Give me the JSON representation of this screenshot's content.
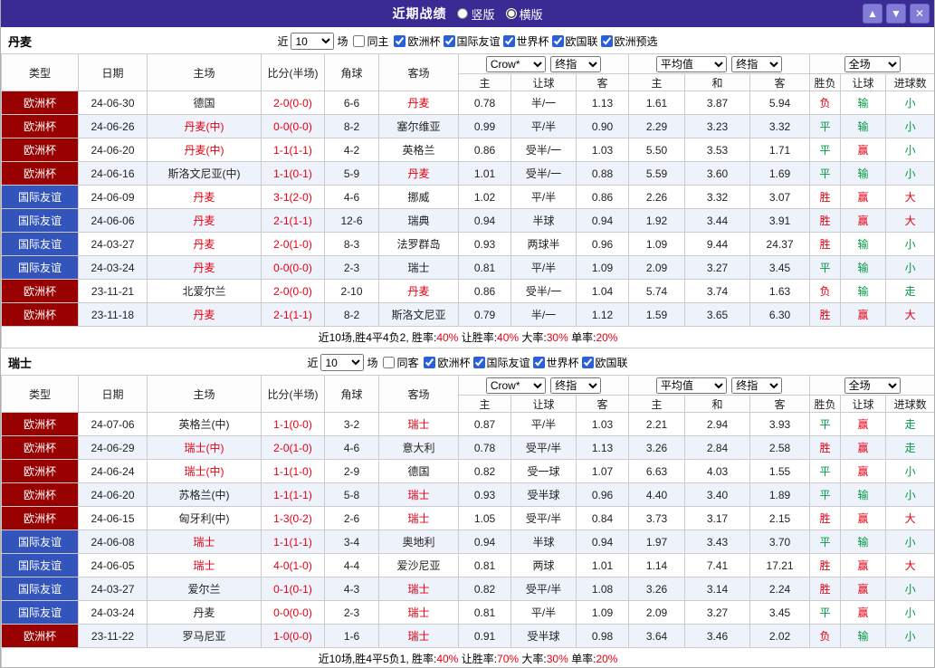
{
  "palette": {
    "topbar_bg": "#392a94",
    "euro_bg": "#990000",
    "friendly_bg": "#3355bb",
    "red_text": "#e60012",
    "green_text": "#009944",
    "alt_row_bg": "#eef2fa"
  },
  "topbar": {
    "title": "近期战绩",
    "layout_options": [
      {
        "label": "竖版",
        "selected": false
      },
      {
        "label": "横版",
        "selected": true
      }
    ],
    "buttons": {
      "up": "▲",
      "down": "▼",
      "close": "✕"
    }
  },
  "filter_labels": {
    "near": "近",
    "count": "10",
    "matches": "场"
  },
  "table_header": {
    "type": "类型",
    "date": "日期",
    "home": "主场",
    "score": "比分(半场)",
    "corner": "角球",
    "away": "客场",
    "book_select": "Crow*",
    "book_index_select": "终指",
    "avg_select": "平均值",
    "avg_index_select": "终指",
    "scope_select": "全场",
    "odds_sub": [
      "主",
      "让球",
      "客"
    ],
    "avg_sub": [
      "主",
      "和",
      "客"
    ],
    "result_sub": [
      "胜负",
      "让球",
      "进球数"
    ]
  },
  "sections": [
    {
      "team": "丹麦",
      "same_venue_label": "同主",
      "same_venue_checked": false,
      "leagues": [
        {
          "label": "欧洲杯",
          "checked": true
        },
        {
          "label": "国际友谊",
          "checked": true
        },
        {
          "label": "世界杯",
          "checked": true
        },
        {
          "label": "欧国联",
          "checked": true
        },
        {
          "label": "欧洲预选",
          "checked": true
        }
      ],
      "rows": [
        {
          "league": "欧洲杯",
          "league_key": "euro",
          "date": "24-06-30",
          "home": "德国",
          "home_hl": false,
          "score": "2-0(0-0)",
          "corner": "6-6",
          "away": "丹麦",
          "away_hl": true,
          "odds": [
            "0.78",
            "半/一",
            "1.13"
          ],
          "avg": [
            "1.61",
            "3.87",
            "5.94"
          ],
          "results": [
            "负",
            "输",
            "小"
          ],
          "result_colors": [
            "r",
            "g",
            "g"
          ]
        },
        {
          "league": "欧洲杯",
          "league_key": "euro",
          "date": "24-06-26",
          "home": "丹麦(中)",
          "home_hl": true,
          "score": "0-0(0-0)",
          "corner": "8-2",
          "away": "塞尔维亚",
          "away_hl": false,
          "odds": [
            "0.99",
            "平/半",
            "0.90"
          ],
          "avg": [
            "2.29",
            "3.23",
            "3.32"
          ],
          "results": [
            "平",
            "输",
            "小"
          ],
          "result_colors": [
            "g",
            "g",
            "g"
          ]
        },
        {
          "league": "欧洲杯",
          "league_key": "euro",
          "date": "24-06-20",
          "home": "丹麦(中)",
          "home_hl": true,
          "score": "1-1(1-1)",
          "corner": "4-2",
          "away": "英格兰",
          "away_hl": false,
          "odds": [
            "0.86",
            "受半/一",
            "1.03"
          ],
          "avg": [
            "5.50",
            "3.53",
            "1.71"
          ],
          "results": [
            "平",
            "赢",
            "小"
          ],
          "result_colors": [
            "g",
            "r",
            "g"
          ]
        },
        {
          "league": "欧洲杯",
          "league_key": "euro",
          "date": "24-06-16",
          "home": "斯洛文尼亚(中)",
          "home_hl": false,
          "score": "1-1(0-1)",
          "corner": "5-9",
          "away": "丹麦",
          "away_hl": true,
          "odds": [
            "1.01",
            "受半/一",
            "0.88"
          ],
          "avg": [
            "5.59",
            "3.60",
            "1.69"
          ],
          "results": [
            "平",
            "输",
            "小"
          ],
          "result_colors": [
            "g",
            "g",
            "g"
          ]
        },
        {
          "league": "国际友谊",
          "league_key": "friendly",
          "date": "24-06-09",
          "home": "丹麦",
          "home_hl": true,
          "score": "3-1(2-0)",
          "corner": "4-6",
          "away": "挪威",
          "away_hl": false,
          "odds": [
            "1.02",
            "平/半",
            "0.86"
          ],
          "avg": [
            "2.26",
            "3.32",
            "3.07"
          ],
          "results": [
            "胜",
            "赢",
            "大"
          ],
          "result_colors": [
            "r",
            "r",
            "r"
          ]
        },
        {
          "league": "国际友谊",
          "league_key": "friendly",
          "date": "24-06-06",
          "home": "丹麦",
          "home_hl": true,
          "score": "2-1(1-1)",
          "corner": "12-6",
          "away": "瑞典",
          "away_hl": false,
          "odds": [
            "0.94",
            "半球",
            "0.94"
          ],
          "avg": [
            "1.92",
            "3.44",
            "3.91"
          ],
          "results": [
            "胜",
            "赢",
            "大"
          ],
          "result_colors": [
            "r",
            "r",
            "r"
          ]
        },
        {
          "league": "国际友谊",
          "league_key": "friendly",
          "date": "24-03-27",
          "home": "丹麦",
          "home_hl": true,
          "score": "2-0(1-0)",
          "corner": "8-3",
          "away": "法罗群岛",
          "away_hl": false,
          "odds": [
            "0.93",
            "两球半",
            "0.96"
          ],
          "avg": [
            "1.09",
            "9.44",
            "24.37"
          ],
          "results": [
            "胜",
            "输",
            "小"
          ],
          "result_colors": [
            "r",
            "g",
            "g"
          ]
        },
        {
          "league": "国际友谊",
          "league_key": "friendly",
          "date": "24-03-24",
          "home": "丹麦",
          "home_hl": true,
          "score": "0-0(0-0)",
          "corner": "2-3",
          "away": "瑞士",
          "away_hl": false,
          "odds": [
            "0.81",
            "平/半",
            "1.09"
          ],
          "avg": [
            "2.09",
            "3.27",
            "3.45"
          ],
          "results": [
            "平",
            "输",
            "小"
          ],
          "result_colors": [
            "g",
            "g",
            "g"
          ]
        },
        {
          "league": "欧洲杯",
          "league_key": "euro",
          "date": "23-11-21",
          "home": "北爱尔兰",
          "home_hl": false,
          "score": "2-0(0-0)",
          "corner": "2-10",
          "away": "丹麦",
          "away_hl": true,
          "odds": [
            "0.86",
            "受半/一",
            "1.04"
          ],
          "avg": [
            "5.74",
            "3.74",
            "1.63"
          ],
          "results": [
            "负",
            "输",
            "走"
          ],
          "result_colors": [
            "r",
            "g",
            "g"
          ]
        },
        {
          "league": "欧洲杯",
          "league_key": "euro",
          "date": "23-11-18",
          "home": "丹麦",
          "home_hl": true,
          "score": "2-1(1-1)",
          "corner": "8-2",
          "away": "斯洛文尼亚",
          "away_hl": false,
          "odds": [
            "0.79",
            "半/一",
            "1.12"
          ],
          "avg": [
            "1.59",
            "3.65",
            "6.30"
          ],
          "results": [
            "胜",
            "赢",
            "大"
          ],
          "result_colors": [
            "r",
            "r",
            "r"
          ]
        }
      ],
      "summary": [
        {
          "t": "近10场,胜4平4负2, 胜率:",
          "c": "k"
        },
        {
          "t": "40%",
          "c": "r"
        },
        {
          "t": " 让胜率:",
          "c": "k"
        },
        {
          "t": "40%",
          "c": "r"
        },
        {
          "t": " 大率:",
          "c": "k"
        },
        {
          "t": "30%",
          "c": "r"
        },
        {
          "t": " 单率:",
          "c": "k"
        },
        {
          "t": "20%",
          "c": "r"
        }
      ]
    },
    {
      "team": "瑞士",
      "same_venue_label": "同客",
      "same_venue_checked": false,
      "leagues": [
        {
          "label": "欧洲杯",
          "checked": true
        },
        {
          "label": "国际友谊",
          "checked": true
        },
        {
          "label": "世界杯",
          "checked": true
        },
        {
          "label": "欧国联",
          "checked": true
        }
      ],
      "rows": [
        {
          "league": "欧洲杯",
          "league_key": "euro",
          "date": "24-07-06",
          "home": "英格兰(中)",
          "home_hl": false,
          "score": "1-1(0-0)",
          "corner": "3-2",
          "away": "瑞士",
          "away_hl": true,
          "odds": [
            "0.87",
            "平/半",
            "1.03"
          ],
          "avg": [
            "2.21",
            "2.94",
            "3.93"
          ],
          "results": [
            "平",
            "赢",
            "走"
          ],
          "result_colors": [
            "g",
            "r",
            "g"
          ]
        },
        {
          "league": "欧洲杯",
          "league_key": "euro",
          "date": "24-06-29",
          "home": "瑞士(中)",
          "home_hl": true,
          "score": "2-0(1-0)",
          "corner": "4-6",
          "away": "意大利",
          "away_hl": false,
          "odds": [
            "0.78",
            "受平/半",
            "1.13"
          ],
          "avg": [
            "3.26",
            "2.84",
            "2.58"
          ],
          "results": [
            "胜",
            "赢",
            "走"
          ],
          "result_colors": [
            "r",
            "r",
            "g"
          ]
        },
        {
          "league": "欧洲杯",
          "league_key": "euro",
          "date": "24-06-24",
          "home": "瑞士(中)",
          "home_hl": true,
          "score": "1-1(1-0)",
          "corner": "2-9",
          "away": "德国",
          "away_hl": false,
          "odds": [
            "0.82",
            "受一球",
            "1.07"
          ],
          "avg": [
            "6.63",
            "4.03",
            "1.55"
          ],
          "results": [
            "平",
            "赢",
            "小"
          ],
          "result_colors": [
            "g",
            "r",
            "g"
          ]
        },
        {
          "league": "欧洲杯",
          "league_key": "euro",
          "date": "24-06-20",
          "home": "苏格兰(中)",
          "home_hl": false,
          "score": "1-1(1-1)",
          "corner": "5-8",
          "away": "瑞士",
          "away_hl": true,
          "odds": [
            "0.93",
            "受半球",
            "0.96"
          ],
          "avg": [
            "4.40",
            "3.40",
            "1.89"
          ],
          "results": [
            "平",
            "输",
            "小"
          ],
          "result_colors": [
            "g",
            "g",
            "g"
          ]
        },
        {
          "league": "欧洲杯",
          "league_key": "euro",
          "date": "24-06-15",
          "home": "匈牙利(中)",
          "home_hl": false,
          "score": "1-3(0-2)",
          "corner": "2-6",
          "away": "瑞士",
          "away_hl": true,
          "odds": [
            "1.05",
            "受平/半",
            "0.84"
          ],
          "avg": [
            "3.73",
            "3.17",
            "2.15"
          ],
          "results": [
            "胜",
            "赢",
            "大"
          ],
          "result_colors": [
            "r",
            "r",
            "r"
          ]
        },
        {
          "league": "国际友谊",
          "league_key": "friendly",
          "date": "24-06-08",
          "home": "瑞士",
          "home_hl": true,
          "score": "1-1(1-1)",
          "corner": "3-4",
          "away": "奥地利",
          "away_hl": false,
          "odds": [
            "0.94",
            "半球",
            "0.94"
          ],
          "avg": [
            "1.97",
            "3.43",
            "3.70"
          ],
          "results": [
            "平",
            "输",
            "小"
          ],
          "result_colors": [
            "g",
            "g",
            "g"
          ]
        },
        {
          "league": "国际友谊",
          "league_key": "friendly",
          "date": "24-06-05",
          "home": "瑞士",
          "home_hl": true,
          "score": "4-0(1-0)",
          "corner": "4-4",
          "away": "爱沙尼亚",
          "away_hl": false,
          "odds": [
            "0.81",
            "两球",
            "1.01"
          ],
          "avg": [
            "1.14",
            "7.41",
            "17.21"
          ],
          "results": [
            "胜",
            "赢",
            "大"
          ],
          "result_colors": [
            "r",
            "r",
            "r"
          ]
        },
        {
          "league": "国际友谊",
          "league_key": "friendly",
          "date": "24-03-27",
          "home": "爱尔兰",
          "home_hl": false,
          "score": "0-1(0-1)",
          "corner": "4-3",
          "away": "瑞士",
          "away_hl": true,
          "odds": [
            "0.82",
            "受平/半",
            "1.08"
          ],
          "avg": [
            "3.26",
            "3.14",
            "2.24"
          ],
          "results": [
            "胜",
            "赢",
            "小"
          ],
          "result_colors": [
            "r",
            "r",
            "g"
          ]
        },
        {
          "league": "国际友谊",
          "league_key": "friendly",
          "date": "24-03-24",
          "home": "丹麦",
          "home_hl": false,
          "score": "0-0(0-0)",
          "corner": "2-3",
          "away": "瑞士",
          "away_hl": true,
          "odds": [
            "0.81",
            "平/半",
            "1.09"
          ],
          "avg": [
            "2.09",
            "3.27",
            "3.45"
          ],
          "results": [
            "平",
            "赢",
            "小"
          ],
          "result_colors": [
            "g",
            "r",
            "g"
          ]
        },
        {
          "league": "欧洲杯",
          "league_key": "euro",
          "date": "23-11-22",
          "home": "罗马尼亚",
          "home_hl": false,
          "score": "1-0(0-0)",
          "corner": "1-6",
          "away": "瑞士",
          "away_hl": true,
          "odds": [
            "0.91",
            "受半球",
            "0.98"
          ],
          "avg": [
            "3.64",
            "3.46",
            "2.02"
          ],
          "results": [
            "负",
            "输",
            "小"
          ],
          "result_colors": [
            "r",
            "g",
            "g"
          ]
        }
      ],
      "summary": [
        {
          "t": "近10场,胜4平5负1, 胜率:",
          "c": "k"
        },
        {
          "t": "40%",
          "c": "r"
        },
        {
          "t": " 让胜率:",
          "c": "k"
        },
        {
          "t": "70%",
          "c": "r"
        },
        {
          "t": " 大率:",
          "c": "k"
        },
        {
          "t": "30%",
          "c": "r"
        },
        {
          "t": " 单率:",
          "c": "k"
        },
        {
          "t": "20%",
          "c": "r"
        }
      ]
    }
  ]
}
